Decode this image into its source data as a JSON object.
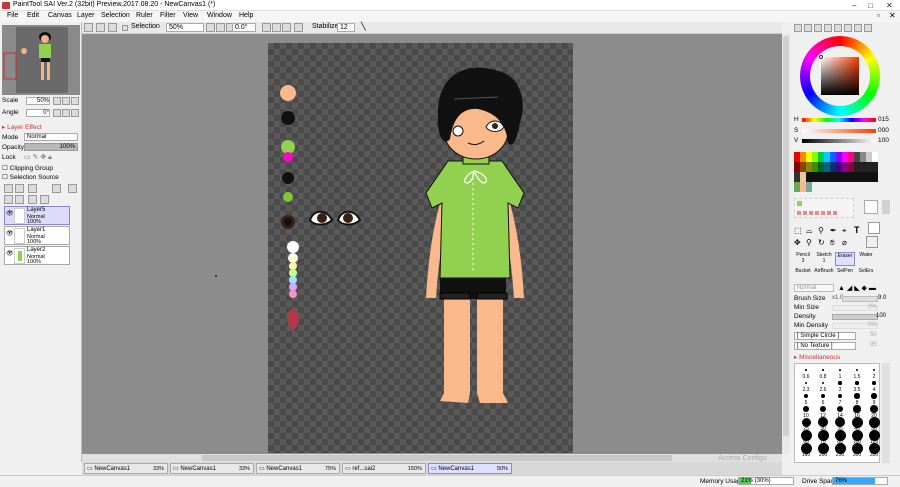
{
  "titlebar": {
    "title": "PaintTool SAI Ver.2 (32bit) Preview.2017.08.20 - NewCanvas1 (*)",
    "minimize": "‒",
    "maximize": "□",
    "close": "✕"
  },
  "menu": [
    "File",
    "Edit",
    "Canvas",
    "Layer",
    "Selection",
    "Ruler",
    "Filter",
    "View",
    "Window",
    "Help"
  ],
  "toolbar": {
    "selection_label": "Selection",
    "zoom": "50%",
    "angle": "0.0°",
    "stabilizer_label": "Stabilizer",
    "stabilizer": "12"
  },
  "navigator": {
    "scale_label": "Scale",
    "scale": "50%",
    "angle_label": "Angle",
    "angle": "0°"
  },
  "layerpanel": {
    "layer_effect": "Layer Effect",
    "mode_label": "Mode",
    "mode": "Normal",
    "opacity_label": "Opacity",
    "opacity": "100%",
    "lock_label": "Lock",
    "clipping": "Clipping Group",
    "selsource": "Selection Source",
    "layers": [
      {
        "name": "Layer5",
        "mode": "Normal",
        "opacity": "100%"
      },
      {
        "name": "Layer1",
        "mode": "Normal",
        "opacity": "100%"
      },
      {
        "name": "Layer2",
        "mode": "Normal",
        "opacity": "100%"
      }
    ]
  },
  "color": {
    "h_label": "H",
    "h": "015",
    "s_label": "S",
    "s": "000",
    "v_label": "V",
    "v": "100",
    "accent": "#ff3b00"
  },
  "tools": {
    "items": [
      "Pencil",
      "Sketch",
      "Eraser",
      "Water",
      "Bucket",
      "AirBrush",
      "SelPen",
      "SelErs"
    ],
    "pencil_size": "3",
    "sketch_size": "1",
    "mode": "Normal"
  },
  "brush": {
    "size_label": "Brush Size",
    "size_mult": "x1.0",
    "size": "9.0",
    "minsize_label": "Min Size",
    "minsize": "0%",
    "density_label": "Density",
    "density": "100",
    "mindensity_label": "Min Density",
    "mindensity": "0%",
    "shape": "[ Simple Circle ]",
    "shape_val": "50",
    "texture": "[ No Texture ]",
    "texture_val": "95",
    "misc": "Miscellaneous"
  },
  "dots": [
    "0.6",
    "0.8",
    "1",
    "1.5",
    "2",
    "2.3",
    "2.6",
    "3",
    "3.5",
    "4",
    "5",
    "6",
    "7",
    "8",
    "9",
    "10",
    "12",
    "14",
    "16",
    "20",
    "25",
    "30",
    "35",
    "40",
    "50",
    "60",
    "70",
    "80",
    "100",
    "120",
    "160",
    "200",
    "250",
    "300",
    "350"
  ],
  "tabs": [
    {
      "name": "NewCanvas1",
      "pct": "33%"
    },
    {
      "name": "NewCanvas1",
      "pct": "33%"
    },
    {
      "name": "NewCanvas1",
      "pct": "75%"
    },
    {
      "name": "ref...sai2",
      "pct": "150%"
    },
    {
      "name": "NewCanvas1",
      "pct": "50%"
    }
  ],
  "status": {
    "memory_label": "Memory Usage",
    "memory": "21% (30%)",
    "drive_label": "Drive Space",
    "drive": "76%"
  },
  "watermark": "Access Configu"
}
